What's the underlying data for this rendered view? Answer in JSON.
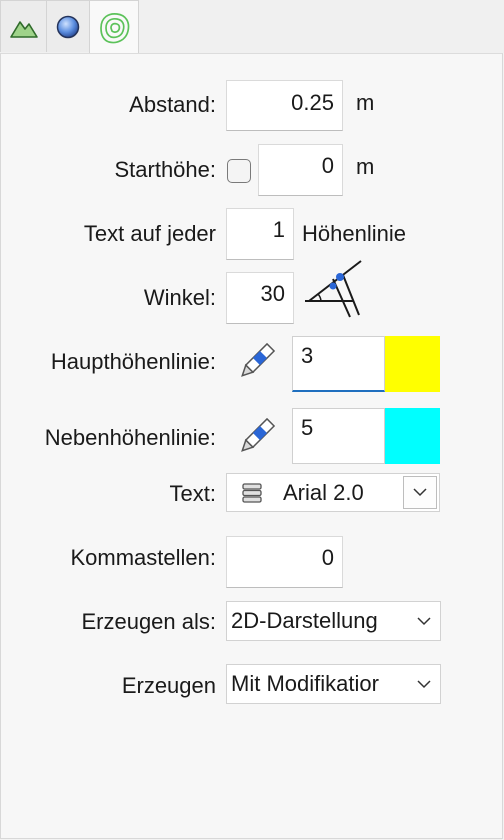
{
  "tabs": [
    {
      "icon": "terrain-icon"
    },
    {
      "icon": "globe-sphere-icon"
    },
    {
      "icon": "contour-lines-icon",
      "active": true
    }
  ],
  "form": {
    "abstand": {
      "label": "Abstand:",
      "value": "0.25",
      "unit": "m"
    },
    "starthoehe": {
      "label": "Starthöhe:",
      "value": "0",
      "unit": "m",
      "checked": false
    },
    "text_jeder": {
      "label": "Text auf jeder",
      "value": "1",
      "suffix": "Höhenlinie"
    },
    "winkel": {
      "label": "Winkel:",
      "value": "30"
    },
    "haupt": {
      "label": "Haupthöhenlinie:",
      "value": "3",
      "color": "#ffff00"
    },
    "neben": {
      "label": "Nebenhöhenlinie:",
      "value": "5",
      "color": "#00ffff"
    },
    "text_font": {
      "label": "Text:",
      "value": "Arial 2.0"
    },
    "kommastellen": {
      "label": "Kommastellen:",
      "value": "0"
    },
    "erzeugen_als": {
      "label": "Erzeugen als:",
      "value": "2D-Darstellung"
    },
    "erzeugen": {
      "label": "Erzeugen",
      "value": "Mit Modifikatior"
    }
  }
}
